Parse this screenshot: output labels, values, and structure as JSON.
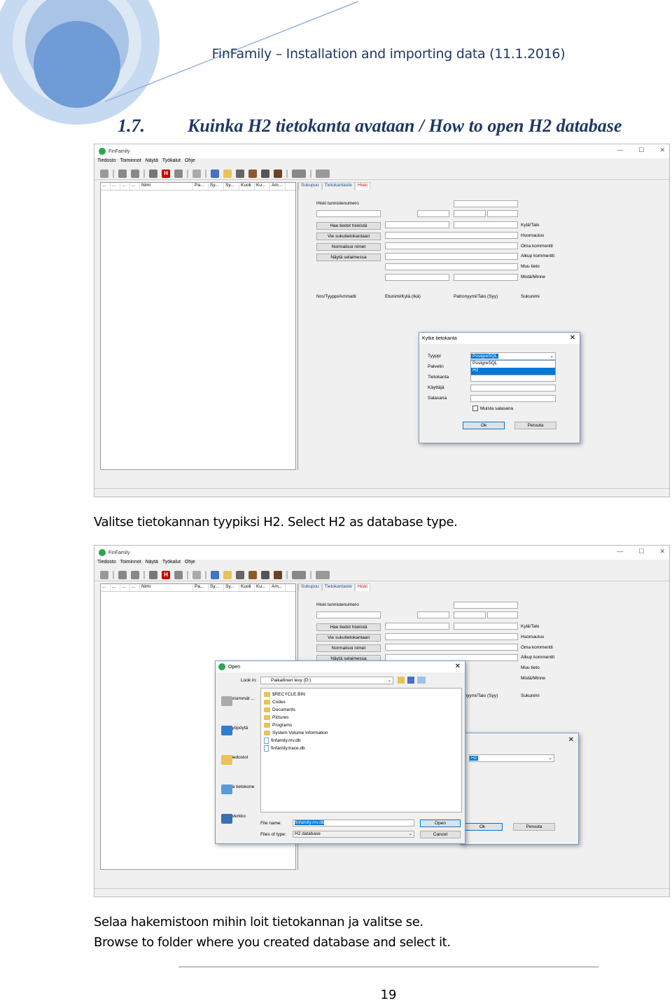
{
  "header": {
    "title": "FinFamily – Installation and importing data (11.1.2016)"
  },
  "section": {
    "number": "1.7.",
    "title": "Kuinka H2 tietokanta avataan / How to open H2 database"
  },
  "captions": {
    "first": "Valitse tietokannan tyypiksi H2. Select H2 as database type.",
    "second_fi": "Selaa hakemistoon mihin loit tietokannan ja valitse se.",
    "second_en": "Browse to folder where you created database and select it."
  },
  "page_number": "19",
  "app": {
    "title": "FinFamily",
    "menu": [
      "Tiedosto",
      "Toiminnot",
      "Näytä",
      "Työkalut",
      "Ohje"
    ],
    "columns": [
      "...",
      "...",
      "...",
      "...",
      "Nimi",
      "Pa...",
      "Sy...",
      "Sy...",
      "Kuoli",
      "Ku...",
      "Am..."
    ],
    "tabs": [
      "Sukupuu",
      "Tietokantaote",
      "Hiski"
    ],
    "hiski": {
      "id_label": "Hiski tunnistenumero",
      "buttons": [
        "Hae tiedot hiskistä",
        "Vie sukutietokantaan",
        "Normalisoi nimet",
        "Näytä selaimessa"
      ],
      "right_labels": [
        "Kylä/Talo",
        "Huomautus",
        "Oma kommentti",
        "Alkup kommentti",
        "Muu tieto",
        "Mistä/Minne"
      ],
      "bottom_labels": [
        "Nro/Tyyppi/Ammatti",
        "Etunimi/Kylä (Ikä)",
        "Patronyymi/Talo (Syy)",
        "Sukunimi"
      ]
    }
  },
  "connect_dialog": {
    "title": "Kytke tietokanta",
    "labels": [
      "Tyyppi",
      "Palvelin",
      "Tietokanta",
      "Käyttäjä",
      "Salasana"
    ],
    "type_value": "PostgreSQL",
    "options": [
      "PostgreSQL",
      "H2"
    ],
    "remember": "Muista salasana",
    "ok": "Ok",
    "cancel": "Peruuta",
    "type_value_2": "H2"
  },
  "open_dialog": {
    "title": "Open",
    "look_in_label": "Look in:",
    "look_in_value": "Paikallinen levy (D:)",
    "places": [
      "Viimeisimmät ...",
      "Työpöytä",
      "Tiedostot",
      "Tämä tietokone",
      "Verkko"
    ],
    "folders": [
      "$RECYCLE.BIN",
      "Codes",
      "Documents",
      "Pictures",
      "Programs",
      "System Volume Information"
    ],
    "files": [
      "finfamily.mv.db",
      "finfamily.trace.db"
    ],
    "file_name_label": "File name:",
    "file_name_value": "finfamily.mv.db",
    "file_type_label": "Files of type:",
    "file_type_value": "H2 database",
    "open_btn": "Open",
    "cancel_btn": "Cancel"
  },
  "colors": {
    "heading": "#1f3864",
    "accent": "#4472c4",
    "light_accent": "#9dc3e6"
  }
}
